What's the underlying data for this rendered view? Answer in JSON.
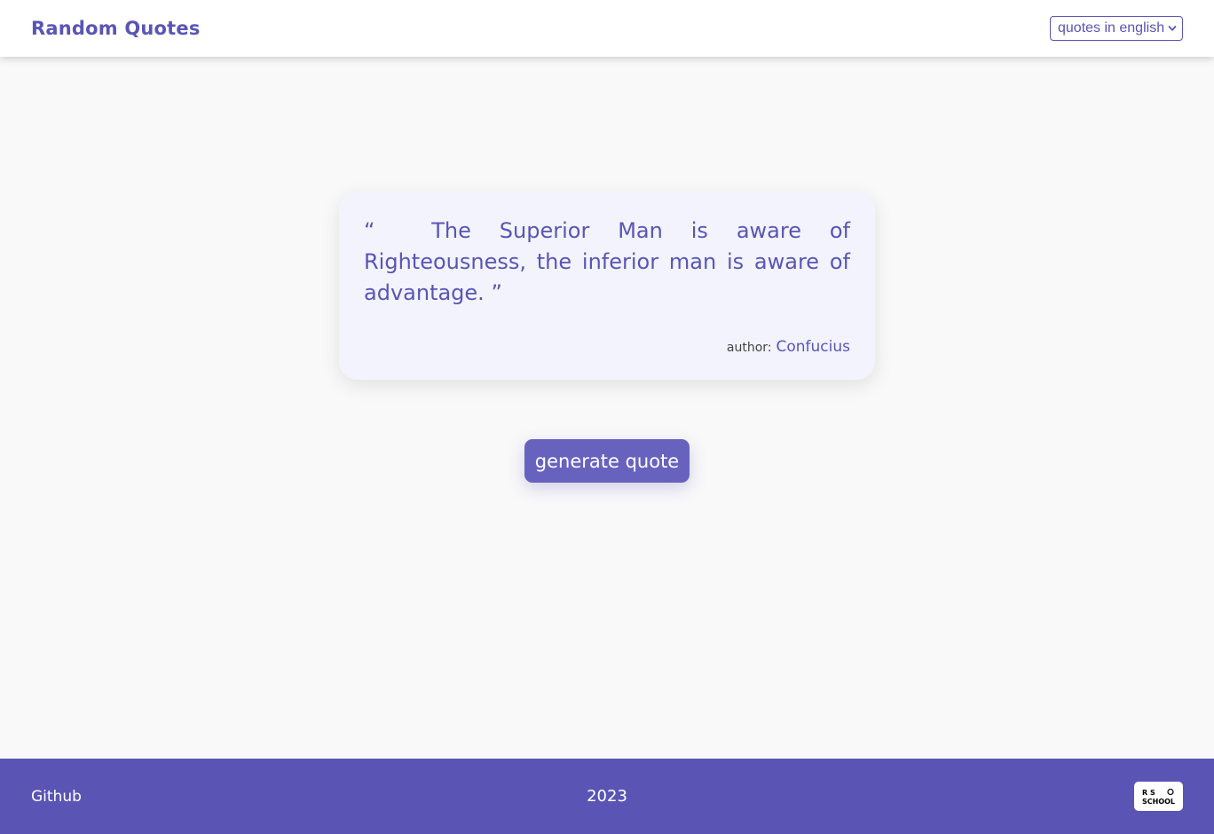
{
  "header": {
    "title": "Random Quotes",
    "language_select": {
      "selected": "quotes in english",
      "icon": "chevron-down-icon"
    }
  },
  "quote": {
    "open_mark": "“",
    "text": "The Superior Man is aware of Righteousness, the inferior man is aware of advantage.",
    "close_mark": "”",
    "author_label": "author:",
    "author_name": "Confucius"
  },
  "actions": {
    "generate_label": "generate quote"
  },
  "footer": {
    "github_label": "Github",
    "year": "2023",
    "logo_text_top": "R  S",
    "logo_text_bottom": "SCHOOL"
  },
  "colors": {
    "brand": "#5a55b4",
    "button": "#6862bf",
    "card_bg": "#f2f3fd",
    "page_bg": "#f9f9f9"
  }
}
